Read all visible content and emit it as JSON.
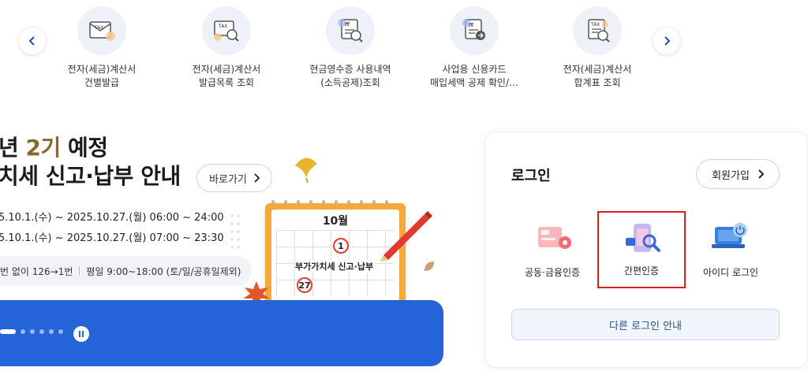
{
  "quick_menu": {
    "items": [
      {
        "label_line1": "전자(세금)계산서",
        "label_line2": "건별발급",
        "icon": "tax-invoice-icon"
      },
      {
        "label_line1": "전자(세금)계산서",
        "label_line2": "발급목록 조회",
        "icon": "tax-invoice-search-icon"
      },
      {
        "label_line1": "현금영수증 사용내역",
        "label_line2": "(소득공제)조회",
        "icon": "cash-receipt-search-icon"
      },
      {
        "label_line1": "사업용 신용카드",
        "label_line2": "매입세액 공제 확인/…",
        "icon": "business-card-receipt-icon"
      },
      {
        "label_line1": "전자(세금)계산서",
        "label_line2": "합계표 조회",
        "icon": "tax-invoice-summary-icon"
      }
    ]
  },
  "banner": {
    "title_prefix": "년 ",
    "title_accent": "2기",
    "title_suffix": " 예정",
    "title_line2": "치세 신고·납부 안내",
    "goto_label": "바로가기",
    "schedule_1": "5.10.1.(수) ~ 2025.10.27.(월) 06:00 ~ 24:00",
    "schedule_2": "5.10.1.(수) ~ 2025.10.27.(월) 07:00 ~ 23:30",
    "info_left": "번 없이 126→1번",
    "info_right": "평일 9:00~18:00 (토/일/공휴일제외)",
    "calendar_month": "10월",
    "calendar_day1": "1",
    "calendar_day2": "27",
    "calendar_tag": "부가가치세 신고·납부"
  },
  "login": {
    "title": "로그인",
    "join_label": "회원가입",
    "options": [
      {
        "label": "공동·금융인증",
        "icon": "certificate-icon"
      },
      {
        "label": "간편인증",
        "icon": "simple-auth-icon"
      },
      {
        "label": "아이디 로그인",
        "icon": "id-login-icon"
      }
    ],
    "other_label": "다른 로그인 안내"
  },
  "colors": {
    "accent_blue": "#2563d9",
    "highlight_red": "#e21c1c",
    "title_gold": "#8a6a2a"
  }
}
